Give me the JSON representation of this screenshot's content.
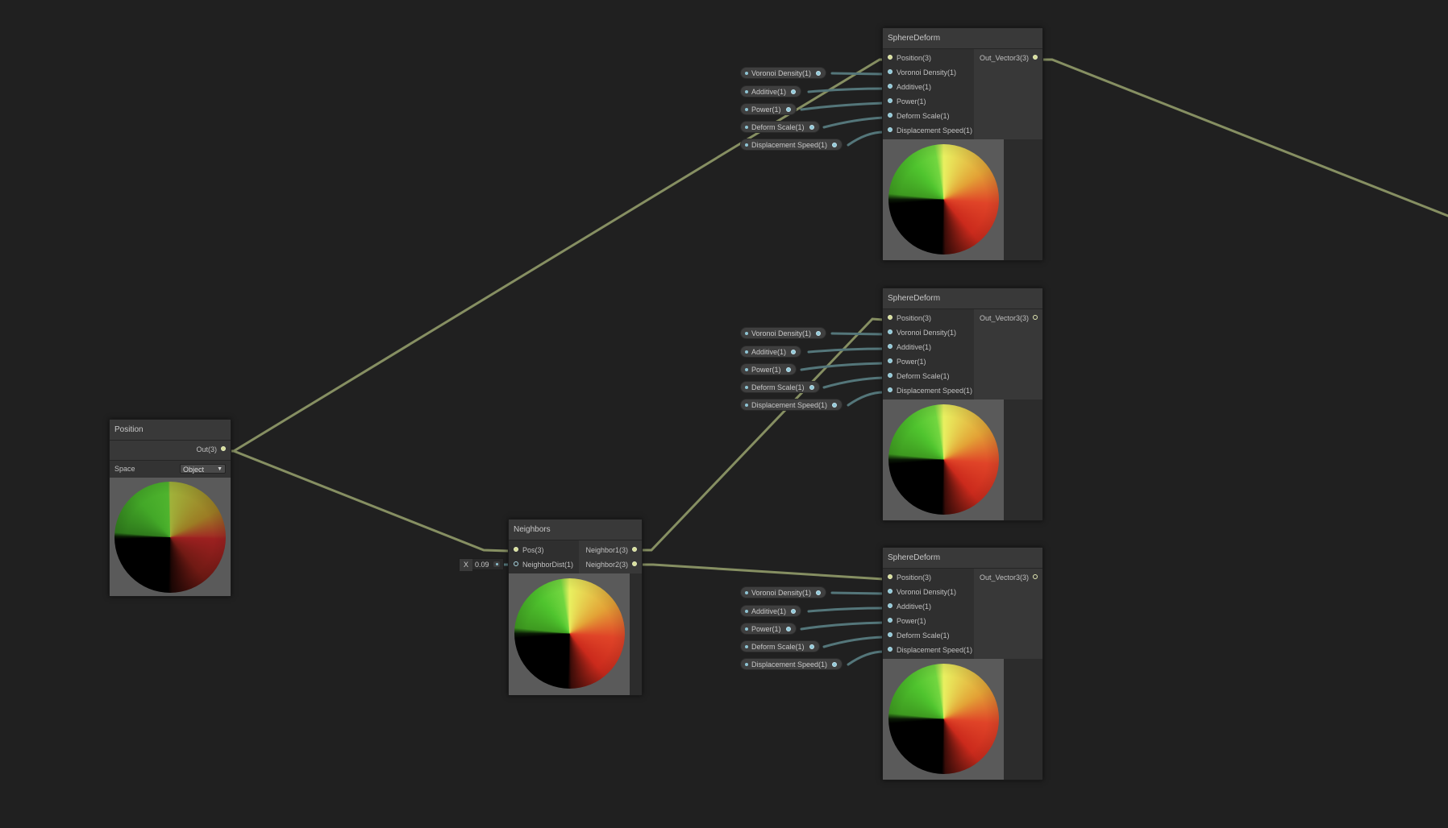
{
  "colors": {
    "background": "#202020",
    "vector3_wire": "#868f62",
    "float_wire": "#54767a",
    "vector3_port": "#d7de98",
    "float_port": "#8fc8d8"
  },
  "position_node": {
    "title": "Position",
    "output": "Out(3)",
    "space_label": "Space",
    "space_value": "Object"
  },
  "neighbors_node": {
    "title": "Neighbors",
    "inputs": [
      "Pos(3)",
      "NeighborDist(1)"
    ],
    "outputs": [
      "Neighbor1(3)",
      "Neighbor2(3)"
    ],
    "dist_field": {
      "axis": "X",
      "value": "0.09"
    }
  },
  "sphere_deform_nodes": [
    {
      "title": "SphereDeform",
      "inputs": [
        "Position(3)",
        "Voronoi Density(1)",
        "Additive(1)",
        "Power(1)",
        "Deform Scale(1)",
        "Displacement Speed(1)"
      ],
      "output": "Out_Vector3(3)",
      "pills": [
        "Voronoi Density(1)",
        "Additive(1)",
        "Power(1)",
        "Deform Scale(1)",
        "Displacement Speed(1)"
      ]
    },
    {
      "title": "SphereDeform",
      "inputs": [
        "Position(3)",
        "Voronoi Density(1)",
        "Additive(1)",
        "Power(1)",
        "Deform Scale(1)",
        "Displacement Speed(1)"
      ],
      "output": "Out_Vector3(3)",
      "pills": [
        "Voronoi Density(1)",
        "Additive(1)",
        "Power(1)",
        "Deform Scale(1)",
        "Displacement Speed(1)"
      ]
    },
    {
      "title": "SphereDeform",
      "inputs": [
        "Position(3)",
        "Voronoi Density(1)",
        "Additive(1)",
        "Power(1)",
        "Deform Scale(1)",
        "Displacement Speed(1)"
      ],
      "output": "Out_Vector3(3)",
      "pills": [
        "Voronoi Density(1)",
        "Additive(1)",
        "Power(1)",
        "Deform Scale(1)",
        "Displacement Speed(1)"
      ]
    }
  ]
}
